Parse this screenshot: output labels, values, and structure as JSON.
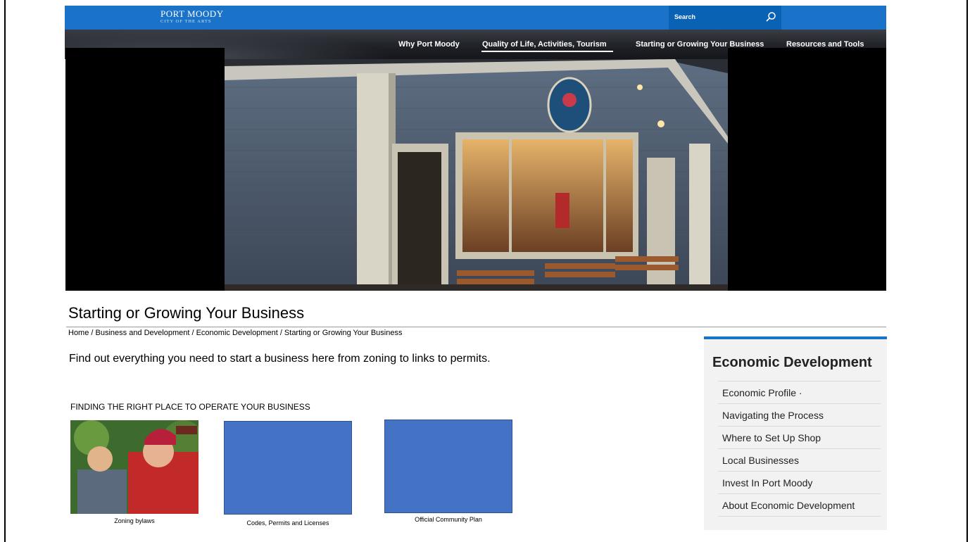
{
  "brand": {
    "name": "PORT MOODY",
    "tagline": "CITY OF THE ARTS"
  },
  "search": {
    "label": "Search",
    "icon": "search-icon"
  },
  "nav": {
    "items": [
      {
        "label": "Why Port Moody",
        "active": false
      },
      {
        "label": "Quality of Life, Activities, Tourism",
        "active": true
      },
      {
        "label": "Starting or Growing Your Business",
        "active": false
      },
      {
        "label": "Resources and Tools",
        "active": false
      }
    ]
  },
  "page": {
    "title": "Starting or Growing Your Business",
    "breadcrumb": "Home / Business and Development  / Economic Development / Starting or Growing Your Business",
    "intro": "Find out everything you need to start a business here from zoning to links to permits.",
    "section_heading": "FINDING THE RIGHT PLACE TO OPERATE YOUR BUSINESS"
  },
  "cards": [
    {
      "caption": "Zoning bylaws"
    },
    {
      "caption": "Codes, Permits and Licenses"
    },
    {
      "caption": "Official Community Plan"
    }
  ],
  "sidebar": {
    "title": "Economic Development",
    "links": [
      {
        "label": "Economic Profile  ·"
      },
      {
        "label": "Navigating the Process"
      },
      {
        "label": "Where to Set Up Shop"
      },
      {
        "label": "Local Businesses"
      },
      {
        "label": "Invest In Port Moody"
      },
      {
        "label": "About Economic Development"
      }
    ]
  },
  "colors": {
    "brand_blue": "#1a73c8",
    "card_blue": "#4472c4",
    "nav_dark": "#1e2026"
  }
}
